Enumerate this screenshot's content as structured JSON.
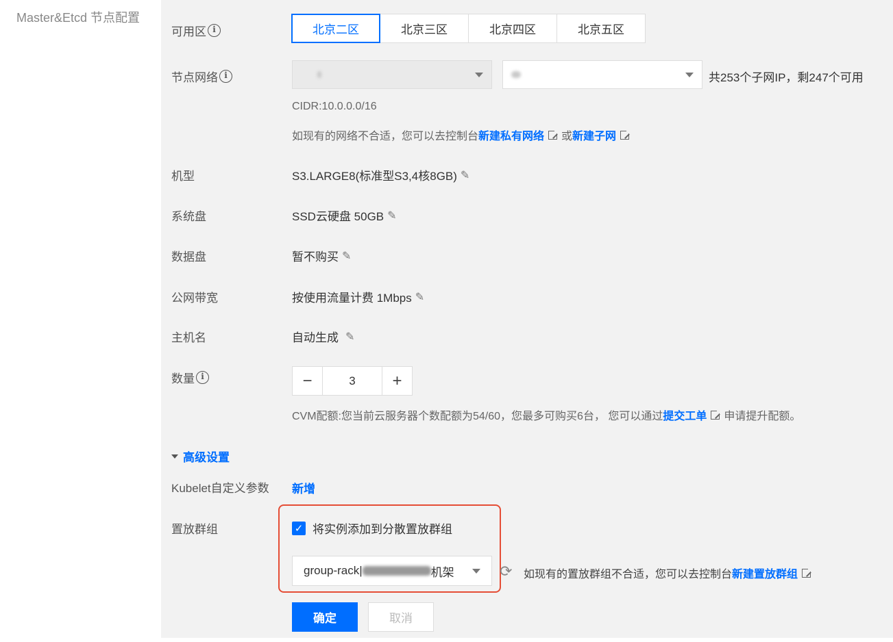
{
  "section_title": "Master&Etcd 节点配置",
  "zone": {
    "label": "可用区",
    "tabs": [
      "北京二区",
      "北京三区",
      "北京四区",
      "北京五区"
    ],
    "active_index": 0
  },
  "network": {
    "label": "节点网络",
    "vpc_value": "",
    "subnet_value": "",
    "subnet_ip_info": "共253个子网IP，剩247个可用",
    "cidr": "CIDR:10.0.0.0/16",
    "hint_prefix": "如现有的网络不合适，您可以去控制台",
    "link_vpc": "新建私有网络",
    "hint_or": "或",
    "link_subnet": "新建子网"
  },
  "instance_type": {
    "label": "机型",
    "value": "S3.LARGE8(标准型S3,4核8GB)"
  },
  "system_disk": {
    "label": "系统盘",
    "value": "SSD云硬盘 50GB"
  },
  "data_disk": {
    "label": "数据盘",
    "value": "暂不购买"
  },
  "bandwidth": {
    "label": "公网带宽",
    "value": "按使用流量计费 1Mbps"
  },
  "hostname": {
    "label": "主机名",
    "value": "自动生成"
  },
  "quantity": {
    "label": "数量",
    "minus": "−",
    "value": "3",
    "plus": "+",
    "quota_prefix": "CVM配额:您当前云服务器个数配额为54/60，您最多可购买6台， 您可以通过",
    "quota_link": "提交工单",
    "quota_suffix": "申请提升配额。"
  },
  "advanced": {
    "toggle_label": "高级设置",
    "kubelet_label": "Kubelet自定义参数",
    "kubelet_add": "新增",
    "placement_label": "置放群组",
    "placement_checkbox": "将实例添加到分散置放群组",
    "placement_checked": true,
    "placement_select_prefix": "group-rack|",
    "placement_select_suffix": "机架",
    "placement_hint": "如现有的置放群组不合适，您可以去控制台",
    "placement_link": "新建置放群组"
  },
  "buttons": {
    "confirm": "确定",
    "cancel": "取消"
  },
  "colors": {
    "accent": "#006eff",
    "highlight_box": "#e54d35"
  }
}
